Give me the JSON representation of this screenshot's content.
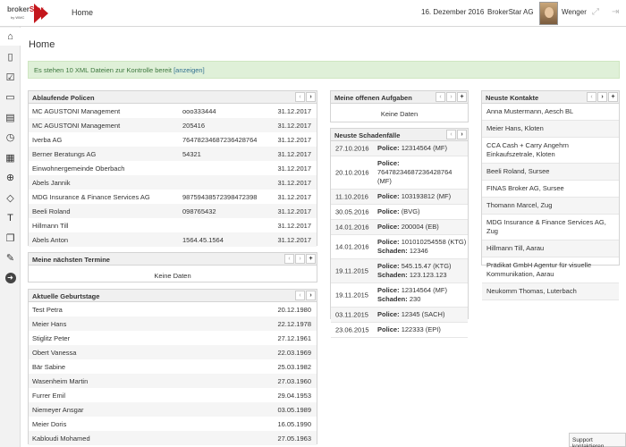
{
  "header": {
    "logo_text_a": "broker",
    "logo_text_b": "Star",
    "logo_sub": "by WMC",
    "nav_home": "Home",
    "date": "16. Dezember 2016",
    "company": "BrokerStar AG",
    "user": "Wenger"
  },
  "sidebar": {
    "items": [
      {
        "icon": "home-icon",
        "glyph": "⌂"
      },
      {
        "icon": "book-icon",
        "glyph": "▯"
      },
      {
        "icon": "checklist-icon",
        "glyph": "☑"
      },
      {
        "icon": "monitor-icon",
        "glyph": "▭"
      },
      {
        "icon": "document-icon",
        "glyph": "▤"
      },
      {
        "icon": "clock-icon",
        "glyph": "◷"
      },
      {
        "icon": "calculator-icon",
        "glyph": "▦"
      },
      {
        "icon": "globe-icon",
        "glyph": "⊕"
      },
      {
        "icon": "tag-icon",
        "glyph": "◇"
      },
      {
        "icon": "text-icon",
        "glyph": "T"
      },
      {
        "icon": "copy-icon",
        "glyph": "❐"
      },
      {
        "icon": "tools-icon",
        "glyph": "✎"
      },
      {
        "icon": "arrow-right-circle-icon",
        "glyph": "➜"
      }
    ]
  },
  "page": {
    "title": "Home",
    "alert_text": "Es stehen 10 XML Dateien zur Kontrolle bereit ",
    "alert_link": "[anzeigen]"
  },
  "policen": {
    "title": "Ablaufende Policen",
    "rows": [
      {
        "name": "MC AGUSTONI Management",
        "num": "ooo333444",
        "date": "31.12.2017"
      },
      {
        "name": "MC AGUSTONI Management",
        "num": "205416",
        "date": "31.12.2017"
      },
      {
        "name": "Iverba AG",
        "num": "76478234687236428764",
        "date": "31.12.2017"
      },
      {
        "name": "Berner Beratungs AG",
        "num": "54321",
        "date": "31.12.2017"
      },
      {
        "name": "Einwohnergemeinde Oberbach",
        "num": "",
        "date": "31.12.2017"
      },
      {
        "name": "Abels Jannik",
        "num": "",
        "date": "31.12.2017"
      },
      {
        "name": "MDG Insurance & Finance Services AG",
        "num": "98759438572398472398",
        "date": "31.12.2017"
      },
      {
        "name": "Beeli Roland",
        "num": "098765432",
        "date": "31.12.2017"
      },
      {
        "name": "Hillmann Till",
        "num": "",
        "date": "31.12.2017"
      },
      {
        "name": "Abels Anton",
        "num": "1564.45.1564",
        "date": "31.12.2017"
      }
    ]
  },
  "termine": {
    "title": "Meine nächsten Termine",
    "empty": "Keine Daten"
  },
  "geburtstage": {
    "title": "Aktuelle Geburtstage",
    "rows": [
      {
        "name": "Test Petra",
        "date": "20.12.1980"
      },
      {
        "name": "Meier Hans",
        "date": "22.12.1978"
      },
      {
        "name": "Stiglitz Peter",
        "date": "27.12.1961"
      },
      {
        "name": "Obert Vanessa",
        "date": "22.03.1969"
      },
      {
        "name": "Bär Sabine",
        "date": "25.03.1982"
      },
      {
        "name": "Wasenheim Martin",
        "date": "27.03.1960"
      },
      {
        "name": "Furrer Emil",
        "date": "29.04.1953"
      },
      {
        "name": "Niemeyer Ansgar",
        "date": "03.05.1989"
      },
      {
        "name": "Meier Doris",
        "date": "16.05.1990"
      },
      {
        "name": "Kabloudi Mohamed",
        "date": "27.05.1963"
      }
    ]
  },
  "aufgaben": {
    "title": "Meine offenen Aufgaben",
    "empty": "Keine Daten"
  },
  "schaden": {
    "title": "Neuste Schadenfälle",
    "rows": [
      {
        "date": "27.10.2016",
        "police_label": "Police:",
        "police": "12314564 (MF)",
        "schaden_label": "",
        "schaden": ""
      },
      {
        "date": "20.10.2016",
        "police_label": "Police:",
        "police": "76478234687236428764 (MF)",
        "schaden_label": "",
        "schaden": ""
      },
      {
        "date": "11.10.2016",
        "police_label": "Police:",
        "police": "103193812 (MF)",
        "schaden_label": "",
        "schaden": ""
      },
      {
        "date": "30.05.2016",
        "police_label": "Police:",
        "police": "(BVG)",
        "schaden_label": "",
        "schaden": ""
      },
      {
        "date": "14.01.2016",
        "police_label": "Police:",
        "police": "200004 (EB)",
        "schaden_label": "",
        "schaden": ""
      },
      {
        "date": "14.01.2016",
        "police_label": "Police:",
        "police": "101010254558 (KTG)",
        "schaden_label": "Schaden:",
        "schaden": "12346"
      },
      {
        "date": "19.11.2015",
        "police_label": "Police:",
        "police": "545.15.47 (KTG)",
        "schaden_label": "Schaden:",
        "schaden": "123.123.123"
      },
      {
        "date": "19.11.2015",
        "police_label": "Police:",
        "police": "12314564 (MF)",
        "schaden_label": "Schaden:",
        "schaden": "230"
      },
      {
        "date": "03.11.2015",
        "police_label": "Police:",
        "police": "12345 (SACH)",
        "schaden_label": "",
        "schaden": ""
      },
      {
        "date": "23.06.2015",
        "police_label": "Police:",
        "police": "122333 (EPI)",
        "schaden_label": "",
        "schaden": ""
      }
    ]
  },
  "kontakte": {
    "title": "Neuste Kontakte",
    "rows": [
      "Anna Mustermann, Aesch BL",
      "Meier Hans, Kloten",
      "CCA Cash + Carry Angehrn Einkaufszetrale, Kloten",
      "Beeli Roland, Sursee",
      "FINAS Broker AG, Sursee",
      "Thomann Marcel, Zug",
      "MDG Insurance & Finance Services AG, Zug",
      "Hillmann Till, Aarau",
      "Prädikat GmbH Agentur für visuelle Kommunikation, Aarau",
      "Neukomm Thomas, Luterbach"
    ]
  },
  "controls": {
    "prev": "‹",
    "next": "›",
    "add": "+"
  },
  "support": {
    "label": "Support kontaktieren"
  }
}
